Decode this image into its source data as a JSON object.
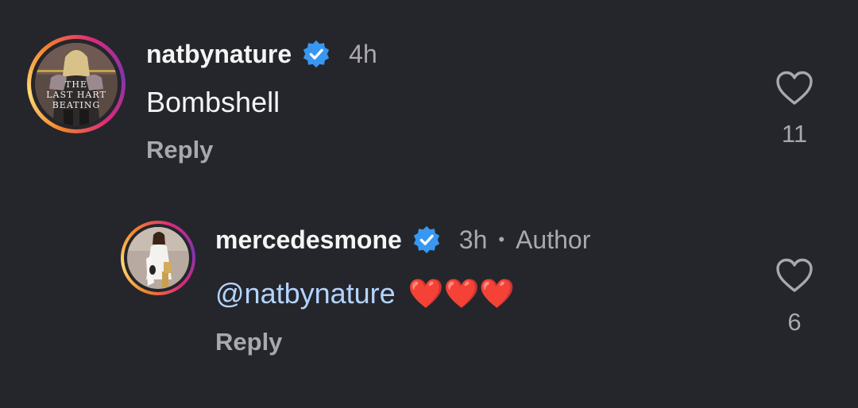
{
  "comments": [
    {
      "username": "natbynature",
      "time": "4h",
      "text": "Bombshell",
      "reply_label": "Reply",
      "like_count": "11",
      "avatar_text": [
        "THE",
        "LAST HART",
        "BEATING"
      ]
    },
    {
      "username": "mercedesmone",
      "time": "3h",
      "separator": "•",
      "author_badge": "Author",
      "mention": "@natbynature",
      "text": "❤️❤️❤️",
      "reply_label": "Reply",
      "like_count": "6"
    }
  ],
  "colors": {
    "background": "#25262b",
    "verified_blue": "#3897f0",
    "mention": "#b3d4ff",
    "muted": "#a8a8ad"
  },
  "icons": {
    "verified": "verified-badge-icon",
    "like": "heart-outline-icon",
    "heart_emoji": "red-heart-emoji"
  }
}
